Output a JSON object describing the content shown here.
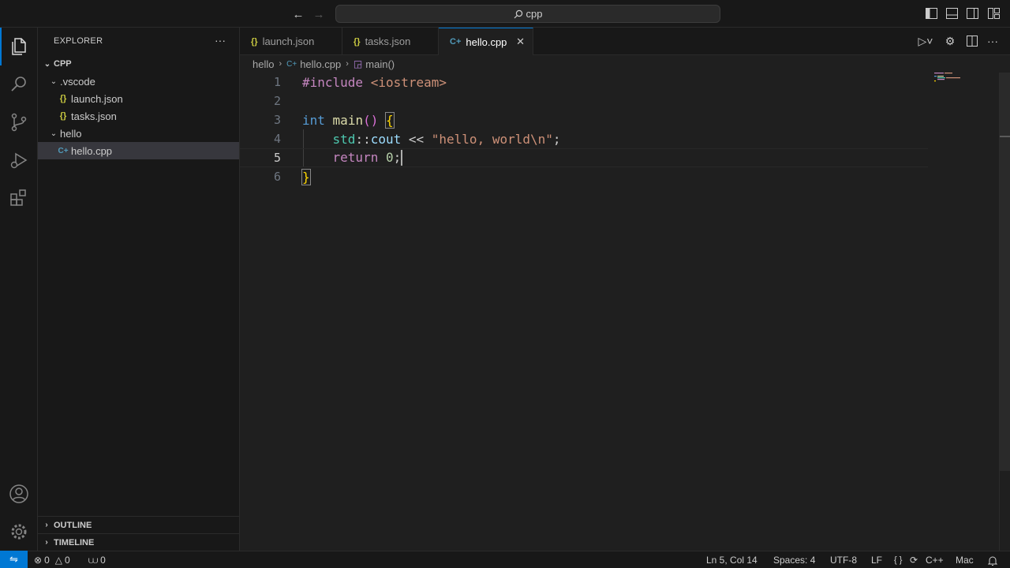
{
  "title_bar": {
    "search_text": "cpp",
    "back_icon": "arrow-left-icon",
    "forward_icon": "arrow-right-icon"
  },
  "activity_bar": {
    "items": [
      "files-icon",
      "search-icon",
      "source-control-icon",
      "run-debug-icon",
      "extensions-icon"
    ],
    "bottom": [
      "account-icon",
      "manage-gear-icon"
    ]
  },
  "sidebar": {
    "title": "EXPLORER",
    "root": "CPP",
    "tree": [
      {
        "label": ".vscode",
        "type": "folder"
      },
      {
        "label": "launch.json",
        "type": "json"
      },
      {
        "label": "tasks.json",
        "type": "json"
      },
      {
        "label": "hello",
        "type": "folder"
      },
      {
        "label": "hello.cpp",
        "type": "cpp"
      }
    ],
    "outline_label": "OUTLINE",
    "timeline_label": "TIMELINE"
  },
  "tabs": [
    {
      "label": "launch.json",
      "icon": "{}",
      "active": false
    },
    {
      "label": "tasks.json",
      "icon": "{}",
      "active": false
    },
    {
      "label": "hello.cpp",
      "icon": "C+",
      "active": true
    }
  ],
  "breadcrumbs": {
    "folder": "hello",
    "file": "hello.cpp",
    "symbol": "main()"
  },
  "editor": {
    "line_numbers": [
      "1",
      "2",
      "3",
      "4",
      "5",
      "6"
    ],
    "current_line": 5,
    "code": {
      "l1_kw": "#include",
      "l1_str": " <iostream>",
      "l3_type": "int",
      "l3_fn": "main",
      "l3_rest": "() ",
      "l3_brace": "{",
      "l4_indent": "    ",
      "l4_ns": "std",
      "l4_sep": "::",
      "l4_var": "cout",
      "l4_op": " << ",
      "l4_str": "\"hello, world\\n\"",
      "l4_end": ";",
      "l5_indent": "    ",
      "l5_kw": "return",
      "l5_sp": " ",
      "l5_num": "0",
      "l5_end": ";",
      "l6_brace": "}"
    }
  },
  "status_bar": {
    "errors": "0",
    "warnings": "0",
    "ports": "0",
    "position": "Ln 5, Col 14",
    "spaces": "Spaces: 4",
    "encoding": "UTF-8",
    "eol": "LF",
    "language": "C++",
    "platform": "Mac"
  },
  "colors": {
    "accent": "#0078d4",
    "background": "#1f1f1f",
    "sidebar": "#181818"
  }
}
